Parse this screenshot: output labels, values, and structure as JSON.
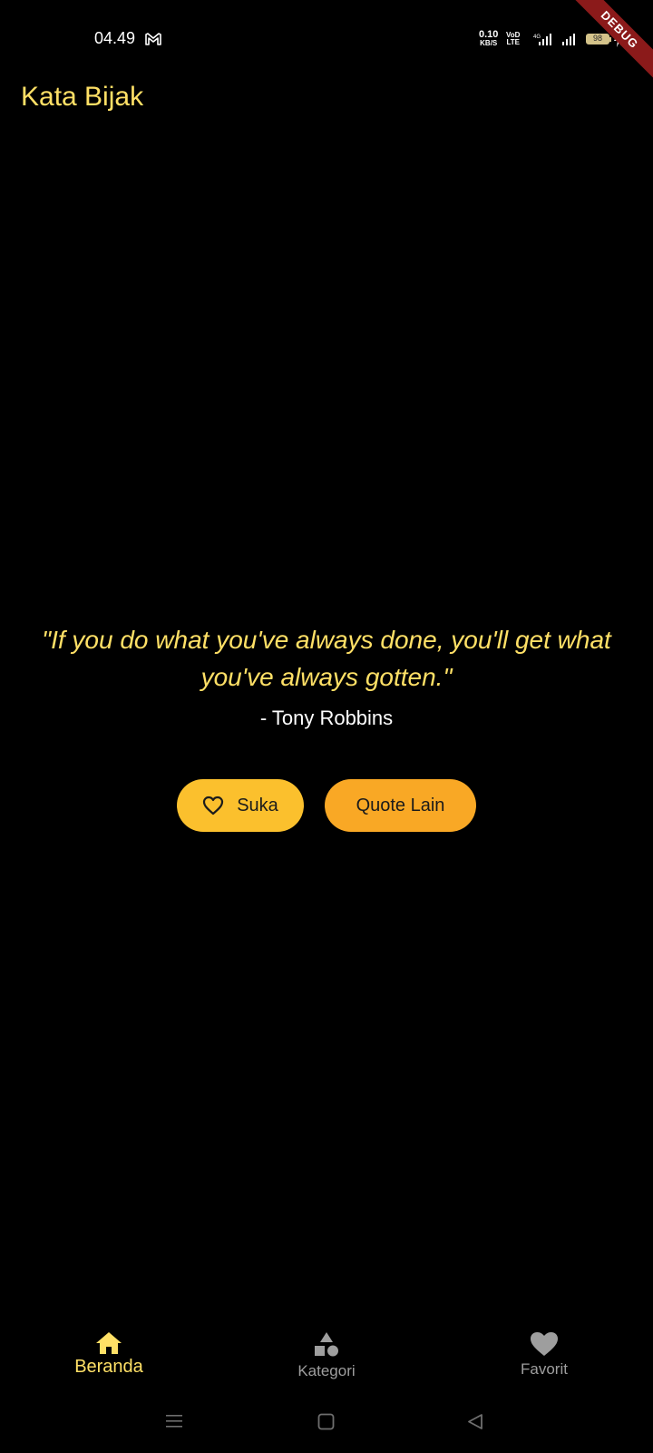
{
  "status_bar": {
    "time": "04.49",
    "net_speed_value": "0.10",
    "net_speed_unit": "KB/S",
    "volte_top": "VoD",
    "volte_bottom": "LTE",
    "network_type": "4G",
    "battery_level": "98"
  },
  "debug_banner": "DEBUG",
  "app_bar": {
    "title": "Kata Bijak"
  },
  "quote": {
    "text": "\"If you do what you've always done, you'll get what you've always gotten.\"",
    "author": "- Tony Robbins"
  },
  "actions": {
    "like_label": "Suka",
    "next_label": "Quote Lain"
  },
  "bottom_nav": {
    "items": [
      {
        "label": "Beranda",
        "icon": "home-icon",
        "active": true
      },
      {
        "label": "Kategori",
        "icon": "category-icon",
        "active": false
      },
      {
        "label": "Favorit",
        "icon": "heart-icon",
        "active": false
      }
    ]
  },
  "colors": {
    "background": "#000000",
    "accent_yellow": "#ffe066",
    "like_button": "#fbc02d",
    "next_button": "#f9a825",
    "inactive_nav": "#9e9e9e",
    "debug_ribbon": "#8b1a1a"
  }
}
